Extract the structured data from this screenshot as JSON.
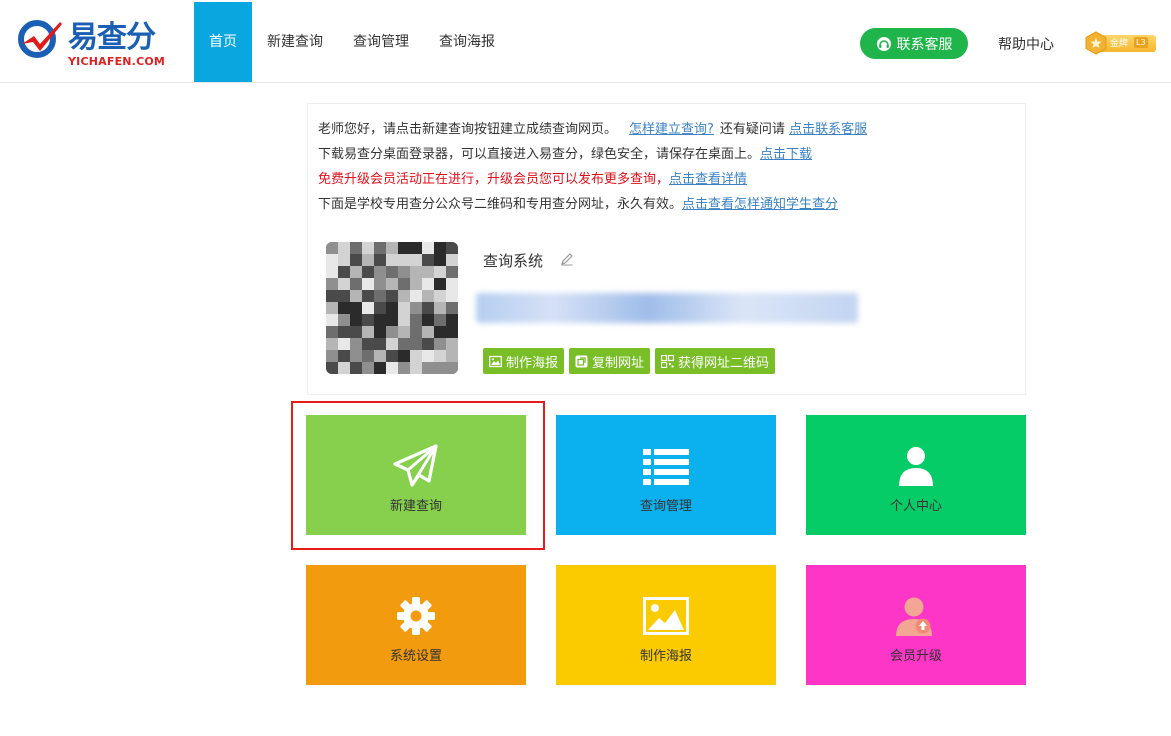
{
  "header": {
    "logo_text": "易查分",
    "logo_sub": "YICHAFEN.COM",
    "nav": [
      "首页",
      "新建查询",
      "查询管理",
      "查询海报"
    ],
    "service_label": "联系客服",
    "help_label": "帮助中心",
    "badge_label": "金牌",
    "badge_level": "L3"
  },
  "info": {
    "line1_text": "老师您好，请点击新建查询按钮建立成绩查询网页。",
    "line1_link1": "怎样建立查询?",
    "line1_mid": "还有疑问请",
    "line1_link2": "点击联系客服",
    "line2_text": "下载易查分桌面登录器，可以直接进入易查分，绿色安全，请保存在桌面上。",
    "line2_link": "点击下载",
    "line3_text": "免费升级会员活动正在进行，升级会员您可以发布更多查询，",
    "line3_link": "点击查看详情",
    "line4_text": "下面是学校专用查分公众号二维码和专用查分网址，永久有效。",
    "line4_link": "点击查看怎样通知学生查分"
  },
  "system": {
    "title": "查询系统",
    "actions": [
      "制作海报",
      "复制网址",
      "获得网址二维码"
    ]
  },
  "tiles": [
    {
      "label": "新建查询",
      "color": "#86d04d",
      "icon": "paper-plane-icon"
    },
    {
      "label": "查询管理",
      "color": "#0bb0ef",
      "icon": "list-icon"
    },
    {
      "label": "个人中心",
      "color": "#06cc67",
      "icon": "user-icon"
    },
    {
      "label": "系统设置",
      "color": "#f29b0e",
      "icon": "gear-icon"
    },
    {
      "label": "制作海报",
      "color": "#fbcb00",
      "icon": "image-icon"
    },
    {
      "label": "会员升级",
      "color": "#fe36c8",
      "icon": "user-upgrade-icon"
    }
  ],
  "colors": {
    "nav_active": "#0aa6e0",
    "service": "#1fb54a",
    "action_green": "#79bd27",
    "highlight": "#e81b1b",
    "red_text": "#e0101a",
    "link": "#3c82c4"
  }
}
